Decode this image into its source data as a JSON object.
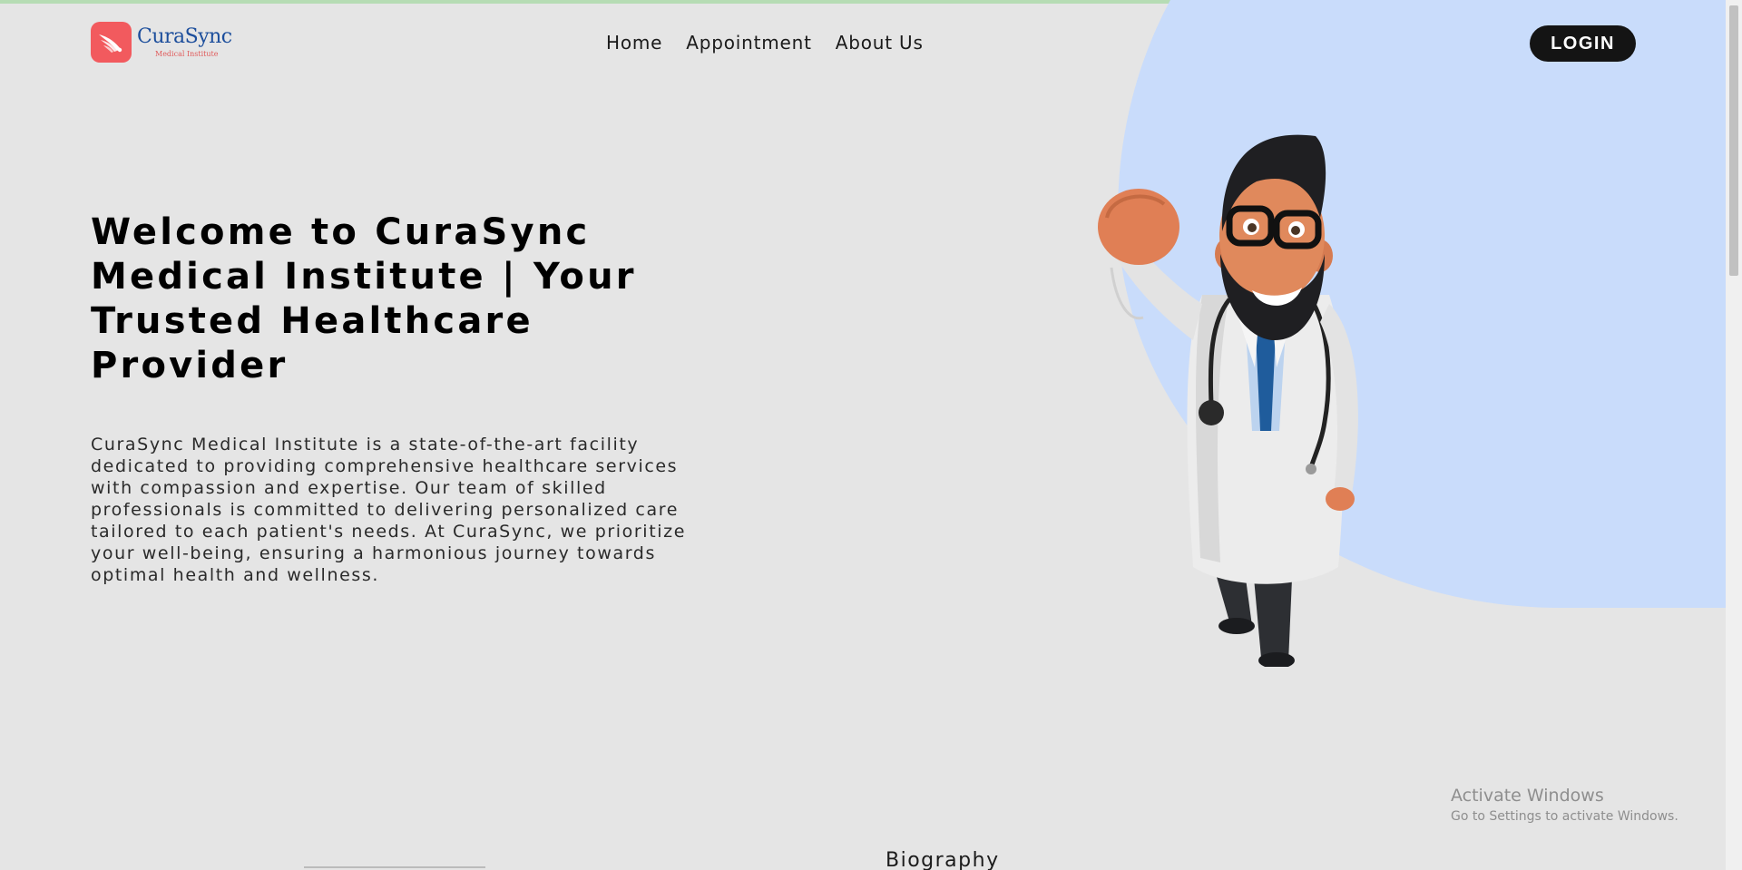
{
  "header": {
    "logo_name": "CuraSync",
    "logo_subtitle": "Medical Institute",
    "nav": [
      "Home",
      "Appointment",
      "About Us"
    ],
    "login_label": "LOGIN"
  },
  "hero": {
    "title": "Welcome to CuraSync Medical Institute | Your Trusted Healthcare Provider",
    "description": "CuraSync Medical Institute is a state-of-the-art facility dedicated to providing comprehensive healthcare services with compassion and expertise. Our team of skilled professionals is committed to delivering personalized care tailored to each patient's needs. At CuraSync, we prioritize your well-being, ensuring a harmonious journey towards optimal health and wellness."
  },
  "next_section": {
    "title": "Biography"
  },
  "os_watermark": {
    "title": "Activate Windows",
    "subtitle": "Go to Settings to activate Windows."
  },
  "icons": {
    "logo": "wing-icon",
    "illustration": "doctor-illustration"
  },
  "colors": {
    "background": "#e5e5e5",
    "accent_blue": "#c9dcfb",
    "logo_red": "#f25a5e",
    "logo_blue": "#1c4e9c",
    "login_bg": "#141414"
  }
}
